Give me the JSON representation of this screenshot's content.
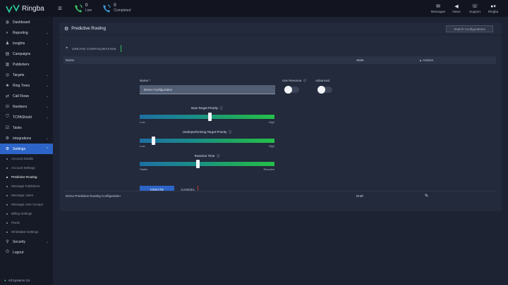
{
  "brand": {
    "name": "Ringba"
  },
  "topbar": {
    "menu_icon": "hamburger-icon",
    "stats": [
      {
        "value": "0",
        "label": "Live",
        "icon": "phone-live-icon"
      },
      {
        "value": "0",
        "label": "Completed",
        "icon": "phone-completed-icon"
      }
    ],
    "right_items": [
      {
        "label": "Messages",
        "icon": "envelope-icon"
      },
      {
        "label": "News",
        "icon": "megaphone-icon"
      },
      {
        "label": "Support",
        "icon": "support-icon"
      },
      {
        "label": "Ringba",
        "icon": "user-icon"
      }
    ]
  },
  "sidebar": {
    "items": [
      {
        "label": "Dashboard",
        "icon": "dashboard-icon",
        "has_chevron": false
      },
      {
        "label": "Reporting",
        "icon": "reporting-icon",
        "has_chevron": true
      },
      {
        "label": "Insights",
        "icon": "insights-icon",
        "has_chevron": true
      },
      {
        "label": "Campaigns",
        "icon": "campaigns-icon",
        "has_chevron": false
      },
      {
        "label": "Publishers",
        "icon": "publishers-icon",
        "has_chevron": false
      },
      {
        "label": "Targets",
        "icon": "targets-icon",
        "has_chevron": true
      },
      {
        "label": "Ring Trees",
        "icon": "ring-trees-icon",
        "has_chevron": true
      },
      {
        "label": "Call Flows",
        "icon": "call-flows-icon",
        "has_chevron": true
      },
      {
        "label": "Numbers",
        "icon": "numbers-icon",
        "has_chevron": true
      },
      {
        "label": "TCPAShield",
        "icon": "shield-icon",
        "has_chevron": true
      },
      {
        "label": "Tasks",
        "icon": "tasks-icon",
        "has_chevron": false
      },
      {
        "label": "Integrations",
        "icon": "integrations-icon",
        "has_chevron": true
      },
      {
        "label": "Settings",
        "icon": "settings-icon",
        "has_chevron": true,
        "active": true
      }
    ],
    "sub_items": [
      {
        "label": "Account Details"
      },
      {
        "label": "Account Settings"
      },
      {
        "label": "Predictive Routing",
        "current": true
      },
      {
        "label": "Message Publishers"
      },
      {
        "label": "Message Users"
      },
      {
        "label": "Message User Groups"
      },
      {
        "label": "Billing Settings"
      },
      {
        "label": "Pixels"
      },
      {
        "label": "Whitelabel Settings"
      }
    ],
    "bottom_items": [
      {
        "label": "Security",
        "icon": "security-icon",
        "has_chevron": true
      },
      {
        "label": "Logout",
        "icon": "logout-icon",
        "has_chevron": false
      }
    ],
    "footer": "All Systems Go"
  },
  "panel": {
    "title": "Predictive Routing",
    "header_button": "Search Configurations",
    "create_link": "CREATE CONFIGURATION",
    "table": {
      "col_name": "Name",
      "col_state": "State",
      "col_actions": "Actions"
    },
    "form": {
      "name_label": "Name *",
      "name_value": "Demo Configuration",
      "use_revenue_label": "Use Revenue",
      "advanced_label": "Advanced",
      "use_revenue_on": false,
      "advanced_on": false,
      "sliders": [
        {
          "title": "New Target Priority",
          "low": "Low",
          "high": "High",
          "value": 0.52
        },
        {
          "title": "Underperforming Target Priority",
          "low": "Low",
          "high": "High",
          "value": 0.09
        },
        {
          "title": "Reaction Time",
          "low": "Stable",
          "high": "Reactive",
          "value": 0.43
        }
      ],
      "create_button": "CREATE",
      "cancel_button": "CANCEL"
    },
    "rows": [
      {
        "name": "Demo Predictive Routing Configuration",
        "state": "Draft",
        "action_icon": "edit-icon"
      }
    ]
  },
  "colors": {
    "accent": "#2d64c8",
    "topbar": "#12151f",
    "sidebar": "#161a26",
    "panel": "#232a3b"
  }
}
